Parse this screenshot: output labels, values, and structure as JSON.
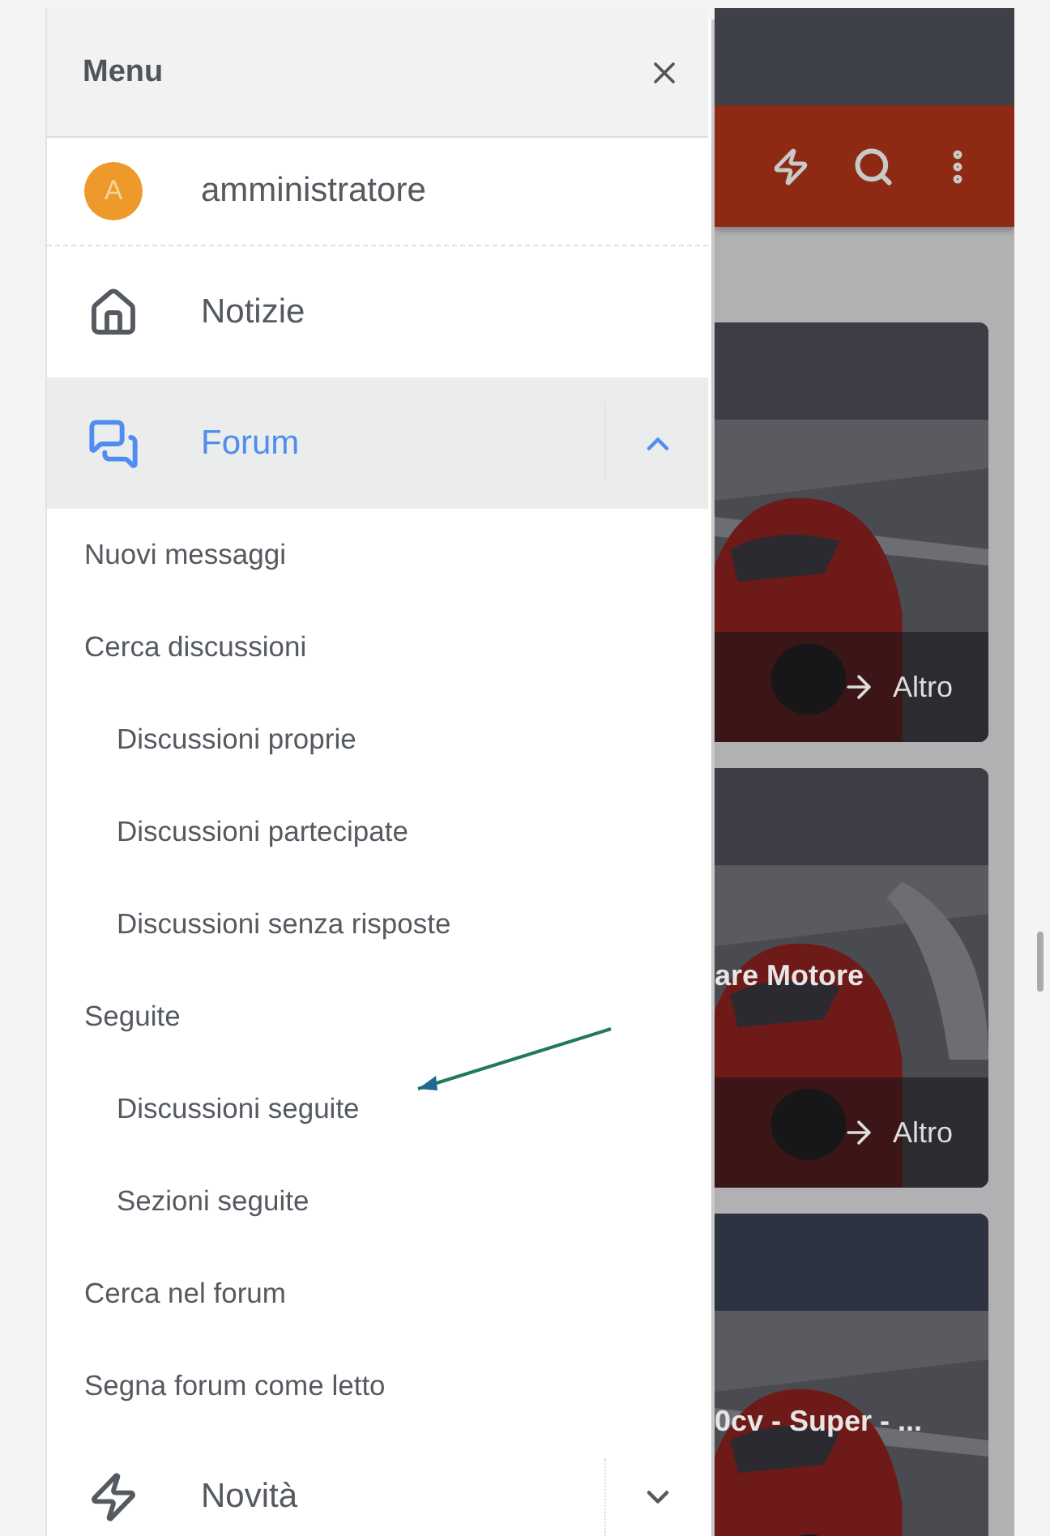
{
  "menu": {
    "title": "Menu"
  },
  "user": {
    "name": "amministratore",
    "initial": "A",
    "color": "#ee9a2b"
  },
  "nav": [
    {
      "label": "Notizie",
      "selected": false
    },
    {
      "label": "Forum",
      "selected": true,
      "expanded": true,
      "children": [
        {
          "label": "Nuovi messaggi"
        },
        {
          "label": "Cerca discussioni",
          "children": [
            {
              "label": "Discussioni proprie"
            },
            {
              "label": "Discussioni partecipate"
            },
            {
              "label": "Discussioni senza risposte"
            }
          ]
        },
        {
          "label": "Seguite",
          "children": [
            {
              "label": "Discussioni seguite"
            },
            {
              "label": "Sezioni seguite"
            }
          ]
        },
        {
          "label": "Cerca nel forum"
        },
        {
          "label": "Segna forum come letto"
        }
      ]
    },
    {
      "label": "Novità",
      "selected": false,
      "expanded": false
    }
  ],
  "background_page": {
    "cards": [
      {
        "more": "Altro"
      },
      {
        "title": "are Motore",
        "more": "Altro"
      },
      {
        "title": "0cv - Super - ..."
      }
    ]
  }
}
